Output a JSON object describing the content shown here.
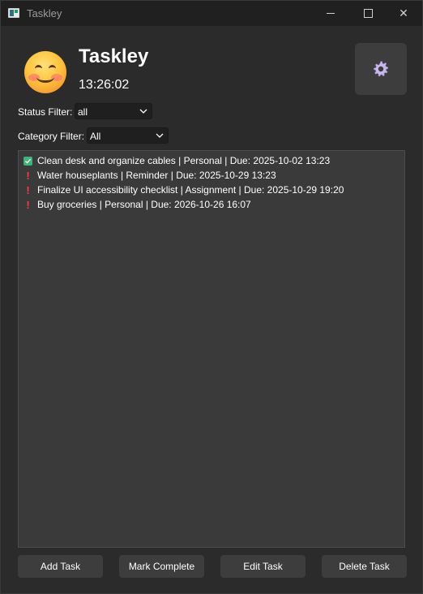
{
  "window": {
    "title": "Taskley",
    "controls": {
      "minimize": "minimize",
      "maximize": "maximize",
      "close": "✕"
    }
  },
  "header": {
    "emoji": "smiling-face-emoji",
    "app_name": "Taskley",
    "clock": "13:26:02",
    "settings_icon": "gear-icon"
  },
  "filters": {
    "status": {
      "label": "Status Filter:",
      "value": "all"
    },
    "category": {
      "label": "Category Filter:",
      "value": "All"
    }
  },
  "tasks": [
    {
      "status": "done",
      "icon": "check-icon",
      "text": "Clean desk and organize cables | Personal | Due: 2025-10-02 13:23"
    },
    {
      "status": "pending",
      "icon": "exclamation-icon",
      "text": "Water houseplants | Reminder | Due: 2025-10-29 13:23"
    },
    {
      "status": "pending",
      "icon": "exclamation-icon",
      "text": "Finalize UI accessibility checklist | Assignment | Due: 2025-10-29 19:20"
    },
    {
      "status": "pending",
      "icon": "exclamation-icon",
      "text": "Buy groceries | Personal | Due: 2026-10-26 16:07"
    }
  ],
  "actions": {
    "add": "Add Task",
    "complete": "Mark Complete",
    "edit": "Edit Task",
    "delete": "Delete Task"
  },
  "colors": {
    "background": "#2b2b2b",
    "list_background": "#3a3a3a",
    "button_background": "#3d3d3d",
    "done_icon": "#3cb47a",
    "pending_icon": "#ff3b3b"
  }
}
